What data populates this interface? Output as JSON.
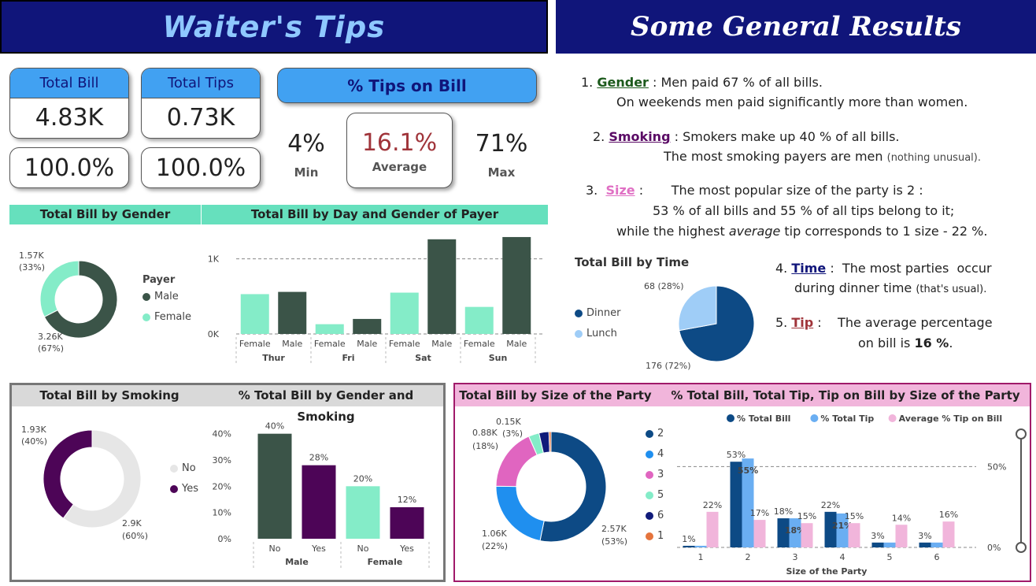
{
  "titles": {
    "left": "Waiter's  Tips",
    "right": "Some General Results"
  },
  "kpis": {
    "total_bill": {
      "label": "Total Bill",
      "value": "4.83K",
      "pct": "100.0%"
    },
    "total_tips": {
      "label": "Total Tips",
      "value": "0.73K",
      "pct": "100.0%"
    },
    "tips_on_bill": {
      "label": "% Tips on Bill",
      "min": "4%",
      "min_label": "Min",
      "avg": "16.1%",
      "avg_label": "Average",
      "max": "71%",
      "max_label": "Max"
    }
  },
  "results": {
    "r1_num": "1.",
    "r1_key": "Gender",
    "r1_text": " :  Men paid 67 % of all bills.",
    "r1_line2": "On weekends men paid significantly more than women.",
    "r2_num": "2.",
    "r2_key": "Smoking",
    "r2_text": " :  Smokers make up 40 % of all bills.",
    "r2_line2": "The most smoking payers are men",
    "r2_note": "(nothing unusual).",
    "r3_num": "3.",
    "r3_key": "Size",
    "r3_text": " :       The most popular size of the party is 2 :",
    "r3_line2": "53 % of all bills and 55 % of all tips belong to it;",
    "r3_line3a": "while the highest ",
    "r3_line3b": "average",
    "r3_line3c": " tip corresponds to 1 size - 22 %.",
    "r4_num": "4.",
    "r4_key": "Time",
    "r4_text": " :  The most parties  occur",
    "r4_line2": "during dinner time",
    "r4_note": "(that's usual).",
    "r5_num": "5.",
    "r5_key": "Tip",
    "r5_text": " :    The average percentage",
    "r5_line2a": "on bill is ",
    "r5_line2b": "16 %",
    "r5_line2c": "."
  },
  "colors": {
    "navy": "#10157a",
    "accent_blue": "#41a1f2",
    "dark_green": "#3b5448",
    "mint": "#84ecc8",
    "purple": "#4d0557",
    "light_grey": "#e6e6e6",
    "dinner": "#0d4a85",
    "lunch": "#9fcdf7",
    "pink": "#f1b5db"
  },
  "chart_data": [
    {
      "type": "pie",
      "title": "Total Bill by Gender",
      "legend_title": "Payer",
      "legend_position": "right",
      "categories": [
        "Male",
        "Female"
      ],
      "values": [
        3.26,
        1.57
      ],
      "labels": [
        [
          "3.26K",
          "(67%)"
        ],
        [
          "1.57K",
          "(33%)"
        ]
      ],
      "colors": [
        "#3b5448",
        "#84ecc8"
      ]
    },
    {
      "type": "bar",
      "title": "Total Bill by Day and Gender of Payer",
      "groups": [
        "Thur",
        "Fri",
        "Sat",
        "Sun"
      ],
      "categories": [
        "Female",
        "Male",
        "Female",
        "Male",
        "Female",
        "Male",
        "Female",
        "Male"
      ],
      "values": [
        0.53,
        0.56,
        0.13,
        0.2,
        0.55,
        1.26,
        0.36,
        1.29
      ],
      "y_ticks": [
        "0K",
        "1K"
      ],
      "ylim": [
        0,
        1.3
      ]
    },
    {
      "type": "pie",
      "title": "Total Bill by Time",
      "legend_position": "left",
      "categories": [
        "Dinner",
        "Lunch"
      ],
      "values": [
        176,
        68
      ],
      "labels": [
        "176 (72%)",
        "68 (28%)"
      ],
      "colors": [
        "#0d4a85",
        "#9fcdf7"
      ]
    },
    {
      "type": "pie",
      "title": "Total Bill by Smoking",
      "legend_position": "right",
      "categories": [
        "No",
        "Yes"
      ],
      "values": [
        2.9,
        1.93
      ],
      "labels": [
        [
          "2.9K",
          "(60%)"
        ],
        [
          "1.93K",
          "(40%)"
        ]
      ],
      "colors": [
        "#e6e6e6",
        "#4d0557"
      ]
    },
    {
      "type": "bar",
      "title": "% Total Bill by Gender and Smoking",
      "groups": [
        "Male",
        "Female"
      ],
      "categories": [
        "No",
        "Yes",
        "No",
        "Yes"
      ],
      "values": [
        40,
        28,
        20,
        12
      ],
      "data_labels": [
        "40%",
        "28%",
        "20%",
        "12%"
      ],
      "y_ticks": [
        "0%",
        "10%",
        "20%",
        "30%",
        "40%"
      ],
      "ylim": [
        0,
        42
      ]
    },
    {
      "type": "pie",
      "title": "Total Bill by Size of the Party",
      "legend_position": "right",
      "categories": [
        "2",
        "4",
        "3",
        "5",
        "6",
        "1"
      ],
      "values": [
        2.57,
        1.06,
        0.88,
        0.15,
        0.14,
        0.03
      ],
      "labels": [
        [
          "2.57K",
          "(53%)"
        ],
        [
          "1.06K",
          "(22%)"
        ],
        [
          "0.88K",
          "(18%)"
        ],
        [
          "0.15K",
          "(3%)"
        ]
      ],
      "colors": [
        "#0d4a85",
        "#1f8fef",
        "#e065c0",
        "#84ecc8",
        "#101b7a",
        "#e5743d"
      ]
    },
    {
      "type": "bar",
      "title": "% Total Bill, Total Tip, Tip on Bill by Size of the Party",
      "xlabel": "Size of the Party",
      "categories": [
        "1",
        "2",
        "3",
        "4",
        "5",
        "6"
      ],
      "series": [
        {
          "name": "% Total Bill",
          "values": [
            1,
            53,
            18,
            22,
            3,
            3
          ],
          "labels": [
            "1%",
            "53%",
            "18%",
            "22%",
            "3%",
            "3%"
          ]
        },
        {
          "name": "% Total Tip",
          "values": [
            1,
            55,
            18,
            21,
            3,
            3
          ],
          "labels": [
            "",
            "55%",
            "18%",
            "21%",
            "",
            ""
          ]
        },
        {
          "name": "Average % Tip on Bill",
          "values": [
            22,
            17,
            15,
            15,
            14,
            16
          ],
          "labels": [
            "22%",
            "17%",
            "15%",
            "15%",
            "14%",
            "16%"
          ]
        }
      ],
      "y_ticks": [
        "0%",
        "50%"
      ],
      "ylim": [
        0,
        57
      ],
      "colors": [
        "#0d4a85",
        "#6aaef2",
        "#f1b5db"
      ]
    }
  ]
}
